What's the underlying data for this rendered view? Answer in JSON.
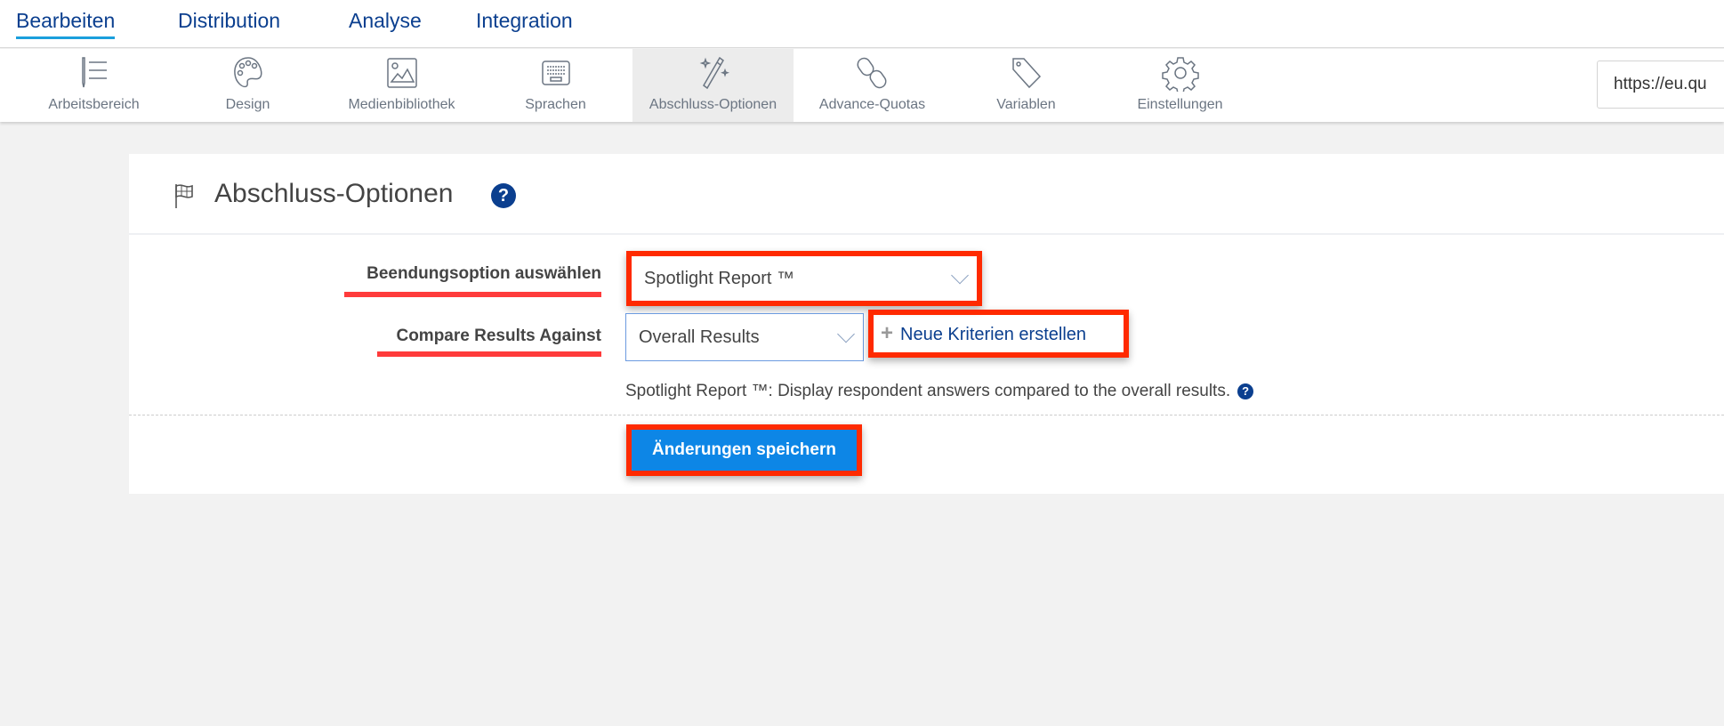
{
  "top_tabs": [
    {
      "label": "Bearbeiten",
      "active": true
    },
    {
      "label": "Distribution"
    },
    {
      "label": "Analyse"
    },
    {
      "label": "Integration"
    }
  ],
  "toolbar": [
    {
      "label": "Arbeitsbereich",
      "icon": "workspace-icon"
    },
    {
      "label": "Design",
      "icon": "palette-icon"
    },
    {
      "label": "Medienbibliothek",
      "icon": "image-icon"
    },
    {
      "label": "Sprachen",
      "icon": "keyboard-icon"
    },
    {
      "label": "Abschluss-Optionen",
      "icon": "magic-wand-icon",
      "active": true
    },
    {
      "label": "Advance-Quotas",
      "icon": "chain-link-icon"
    },
    {
      "label": "Variablen",
      "icon": "tag-icon"
    },
    {
      "label": "Einstellungen",
      "icon": "gear-icon"
    }
  ],
  "url_field": "https://eu.qu",
  "panel": {
    "title": "Abschluss-Optionen",
    "help": "?",
    "end_option_label": "Beendungsoption auswählen",
    "end_option_value": "Spotlight Report ™",
    "compare_label": "Compare Results Against",
    "compare_value": "Overall Results",
    "new_criteria": "Neue Kriterien erstellen",
    "plus": "+",
    "description": "Spotlight Report ™: Display respondent answers compared to the overall results.",
    "save_label": "Änderungen speichern"
  },
  "colors": {
    "brand": "#0b3f8f",
    "accent": "#1a9fdc",
    "button": "#0d86e6",
    "highlight": "#ff2a00"
  }
}
